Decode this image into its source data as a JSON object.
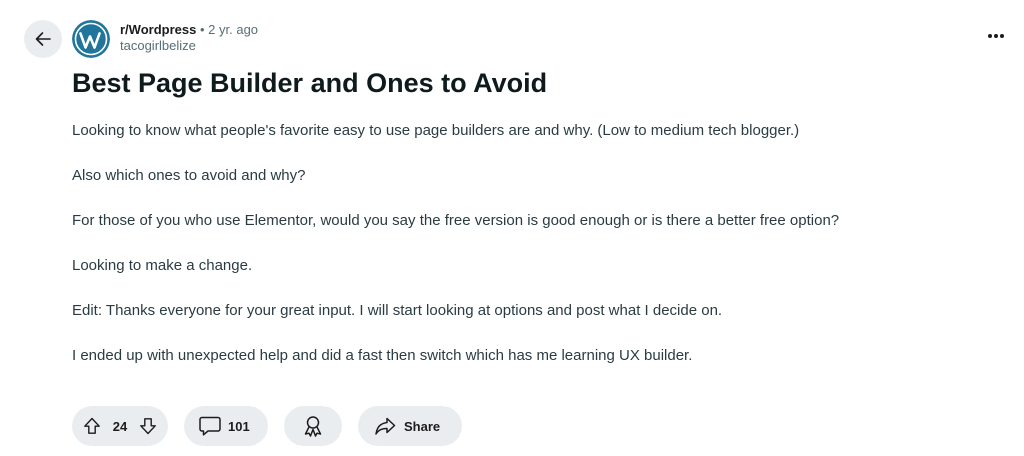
{
  "post": {
    "subreddit": "r/Wordpress",
    "separator": "•",
    "age": "2 yr. ago",
    "author": "tacogirlbelize",
    "title": "Best Page Builder and Ones to Avoid",
    "paragraphs": [
      "Looking to know what people's favorite easy to use page builders are and why. (Low to medium tech blogger.)",
      "Also which ones to avoid and why?",
      "For those of you who use Elementor, would you say the free version is good enough or is there a better free option?",
      "Looking to make a change.",
      "Edit: Thanks everyone for your great input. I will start looking at options and post what I decide on.",
      "I ended up with unexpected help and did a fast then switch which has me learning UX builder."
    ]
  },
  "actions": {
    "score": "24",
    "comments": "101",
    "share_label": "Share"
  },
  "icons": {
    "back": "arrow-left-icon",
    "avatar": "wordpress-logo",
    "more": "more-horizontal-icon",
    "upvote": "arrow-up-outline-icon",
    "downvote": "arrow-down-outline-icon",
    "comment": "speech-bubble-icon",
    "award": "award-ribbon-icon",
    "share": "share-arrow-icon"
  },
  "colors": {
    "pill_background": "#eaedef",
    "wordpress_blue": "#21759b",
    "meta_gray": "#576f76"
  }
}
